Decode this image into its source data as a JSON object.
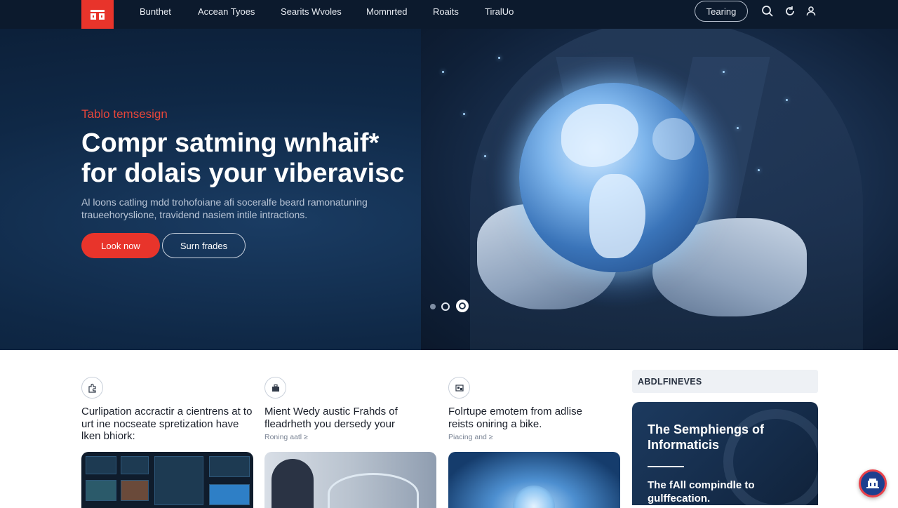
{
  "nav": {
    "links": [
      "Bunthet",
      "Accean Tyoes",
      "Searits Wvoles",
      "Momnrted",
      "Roaits",
      "TiralUo"
    ],
    "cta": "Tearing",
    "icons": [
      "search-icon",
      "refresh-icon",
      "user-icon"
    ]
  },
  "hero": {
    "kicker": "Tablo temsesign",
    "title_line1": "Compr satming wnhaif*",
    "title_line2": "for dolais your viberavisc",
    "subtitle": "Al loons catling mdd trohofoiane afi soceralfe beard ramonatuning traueehoryslione, travidend nasiem intile intractions.",
    "primary_button": "Look now",
    "secondary_button": "Surn frades",
    "carousel_dots": 3
  },
  "cards": [
    {
      "icon": "puzzle-icon",
      "title": "Curlipation accractir a cientrens at to urt ine nocseate spretization have lken bhiork:",
      "meta": ""
    },
    {
      "icon": "briefcase-icon",
      "title": "Mient Wedy austic Frahds of fleadrheth you dersedy your",
      "meta": "Roning aatl ≥"
    },
    {
      "icon": "image-icon",
      "title": "Folrtupe emotem from adlise reists oniring a bike.",
      "meta": "Piacing and ≥"
    }
  ],
  "sidebar": {
    "heading": "ABDLFINEVES",
    "feature_title": "The Semphiengs of Informaticis",
    "feature_sub": "The fAll compindle to gulffecation."
  },
  "colors": {
    "accent": "#e8342b",
    "nav_bg": "#0c1a2d",
    "hero_bg": "#0f2846"
  }
}
